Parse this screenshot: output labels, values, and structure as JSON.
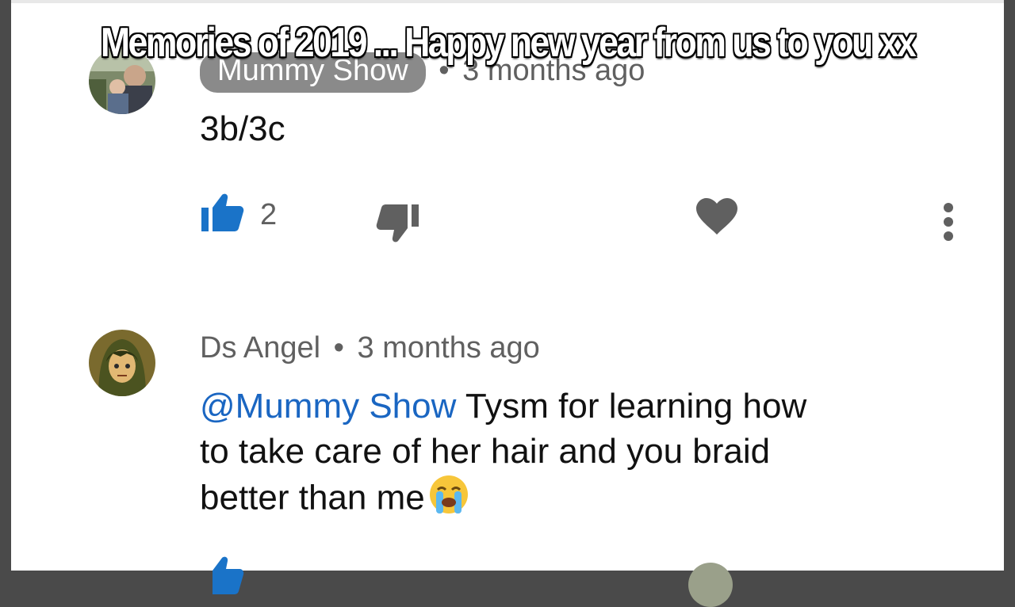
{
  "overlay": {
    "caption": "Memories of 2019 ... Happy new year from us to you xx"
  },
  "comments": [
    {
      "author": "Mummy Show",
      "author_highlighted": true,
      "separator": "•",
      "time": "3 months ago",
      "text": "3b/3c",
      "likes": "2",
      "liked": true,
      "avatar_icon": "family-photo-avatar"
    },
    {
      "author": "Ds Angel",
      "author_highlighted": false,
      "separator": "•",
      "time": "3 months ago",
      "mention": "@Mummy Show",
      "text_line1": " Tysm for learning how",
      "text_line2": "to take care of her hair and you braid",
      "text_line3": "better than me",
      "emoji_icon": "loudly-crying-face-icon",
      "avatar_icon": "anime-avatar"
    }
  ],
  "icons": {
    "like": "thumbs-up-icon",
    "dislike": "thumbs-down-icon",
    "heart": "heart-icon",
    "more": "more-vertical-icon"
  },
  "colors": {
    "like_active": "#1a73c8",
    "icon_gray": "#606060",
    "mention_blue": "#1a66c2",
    "pill_gray": "#8a8a8a"
  }
}
